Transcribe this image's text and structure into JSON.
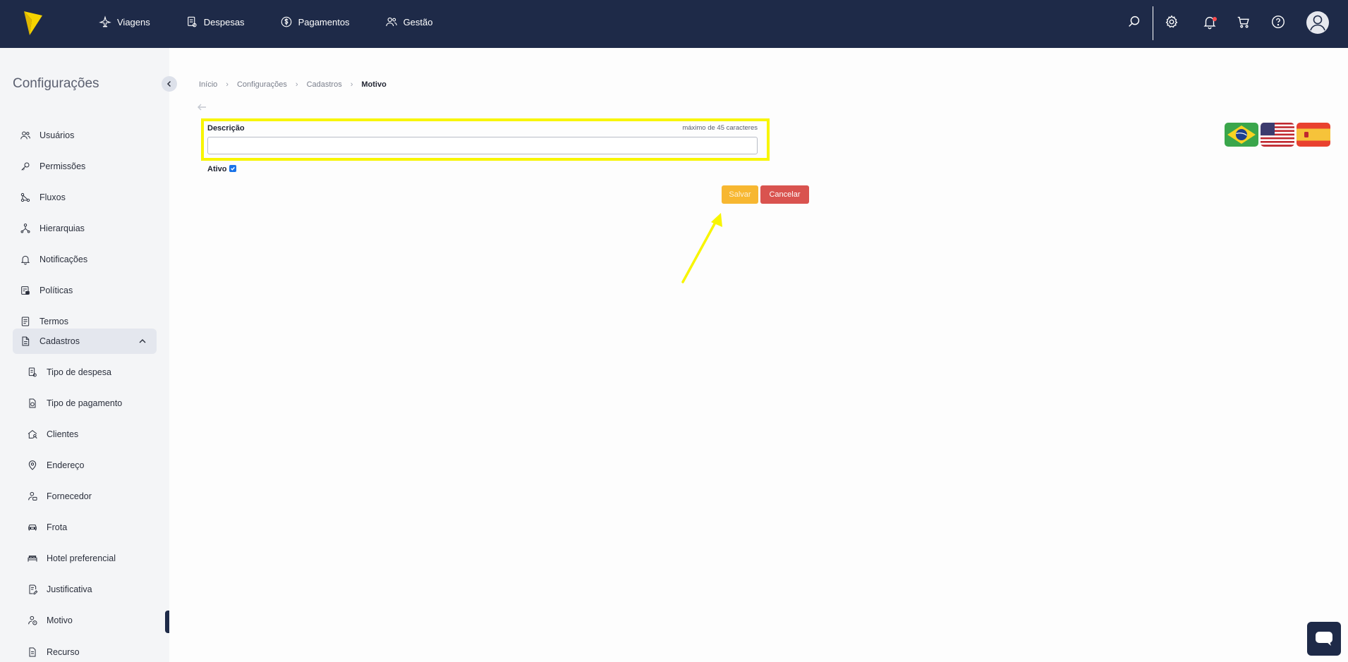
{
  "header": {
    "nav": [
      {
        "label": "Viagens",
        "icon": "plane-icon"
      },
      {
        "label": "Despesas",
        "icon": "receipt-icon"
      },
      {
        "label": "Pagamentos",
        "icon": "dollar-circle-icon"
      },
      {
        "label": "Gestão",
        "icon": "users-icon"
      }
    ],
    "icons": [
      "search-icon",
      "gear-icon",
      "bell-icon",
      "cart-icon",
      "help-icon",
      "avatar"
    ],
    "notification_dot_color": "#ff4d4f",
    "background_color": "#1e2a48"
  },
  "sidebar": {
    "title": "Configurações",
    "items": [
      {
        "label": "Usuários",
        "icon": "users-icon"
      },
      {
        "label": "Permissões",
        "icon": "key-icon"
      },
      {
        "label": "Fluxos",
        "icon": "flow-icon"
      },
      {
        "label": "Hierarquias",
        "icon": "hierarchy-icon"
      },
      {
        "label": "Notificações",
        "icon": "bell-icon"
      },
      {
        "label": "Políticas",
        "icon": "policy-icon"
      },
      {
        "label": "Termos",
        "icon": "document-icon"
      },
      {
        "label": "Cadastros",
        "icon": "file-icon",
        "expanded": true
      }
    ],
    "subitems": [
      {
        "label": "Tipo de despesa",
        "icon": "expense-type-icon"
      },
      {
        "label": "Tipo de pagamento",
        "icon": "payment-type-icon"
      },
      {
        "label": "Clientes",
        "icon": "home-user-icon"
      },
      {
        "label": "Endereço",
        "icon": "location-pin-icon"
      },
      {
        "label": "Fornecedor",
        "icon": "supplier-icon"
      },
      {
        "label": "Frota",
        "icon": "car-icon"
      },
      {
        "label": "Hotel preferencial",
        "icon": "bed-icon"
      },
      {
        "label": "Justificativa",
        "icon": "edit-document-icon"
      },
      {
        "label": "Motivo",
        "icon": "reason-icon",
        "active": true
      },
      {
        "label": "Recurso",
        "icon": "resource-icon"
      }
    ]
  },
  "breadcrumb": [
    "Início",
    "Configurações",
    "Cadastros",
    "Motivo"
  ],
  "form": {
    "description_label": "Descrição",
    "description_hint": "máximo de 45 caracteres",
    "description_value": "",
    "active_label": "Ativo",
    "active_checked": true,
    "save_label": "Salvar",
    "cancel_label": "Cancelar"
  },
  "languages": [
    {
      "name": "brazil-flag-icon"
    },
    {
      "name": "usa-flag-icon"
    },
    {
      "name": "spain-flag-icon"
    }
  ],
  "colors": {
    "accent_save": "#f7b731",
    "accent_cancel": "#d9534f",
    "highlight": "#f8f500"
  }
}
